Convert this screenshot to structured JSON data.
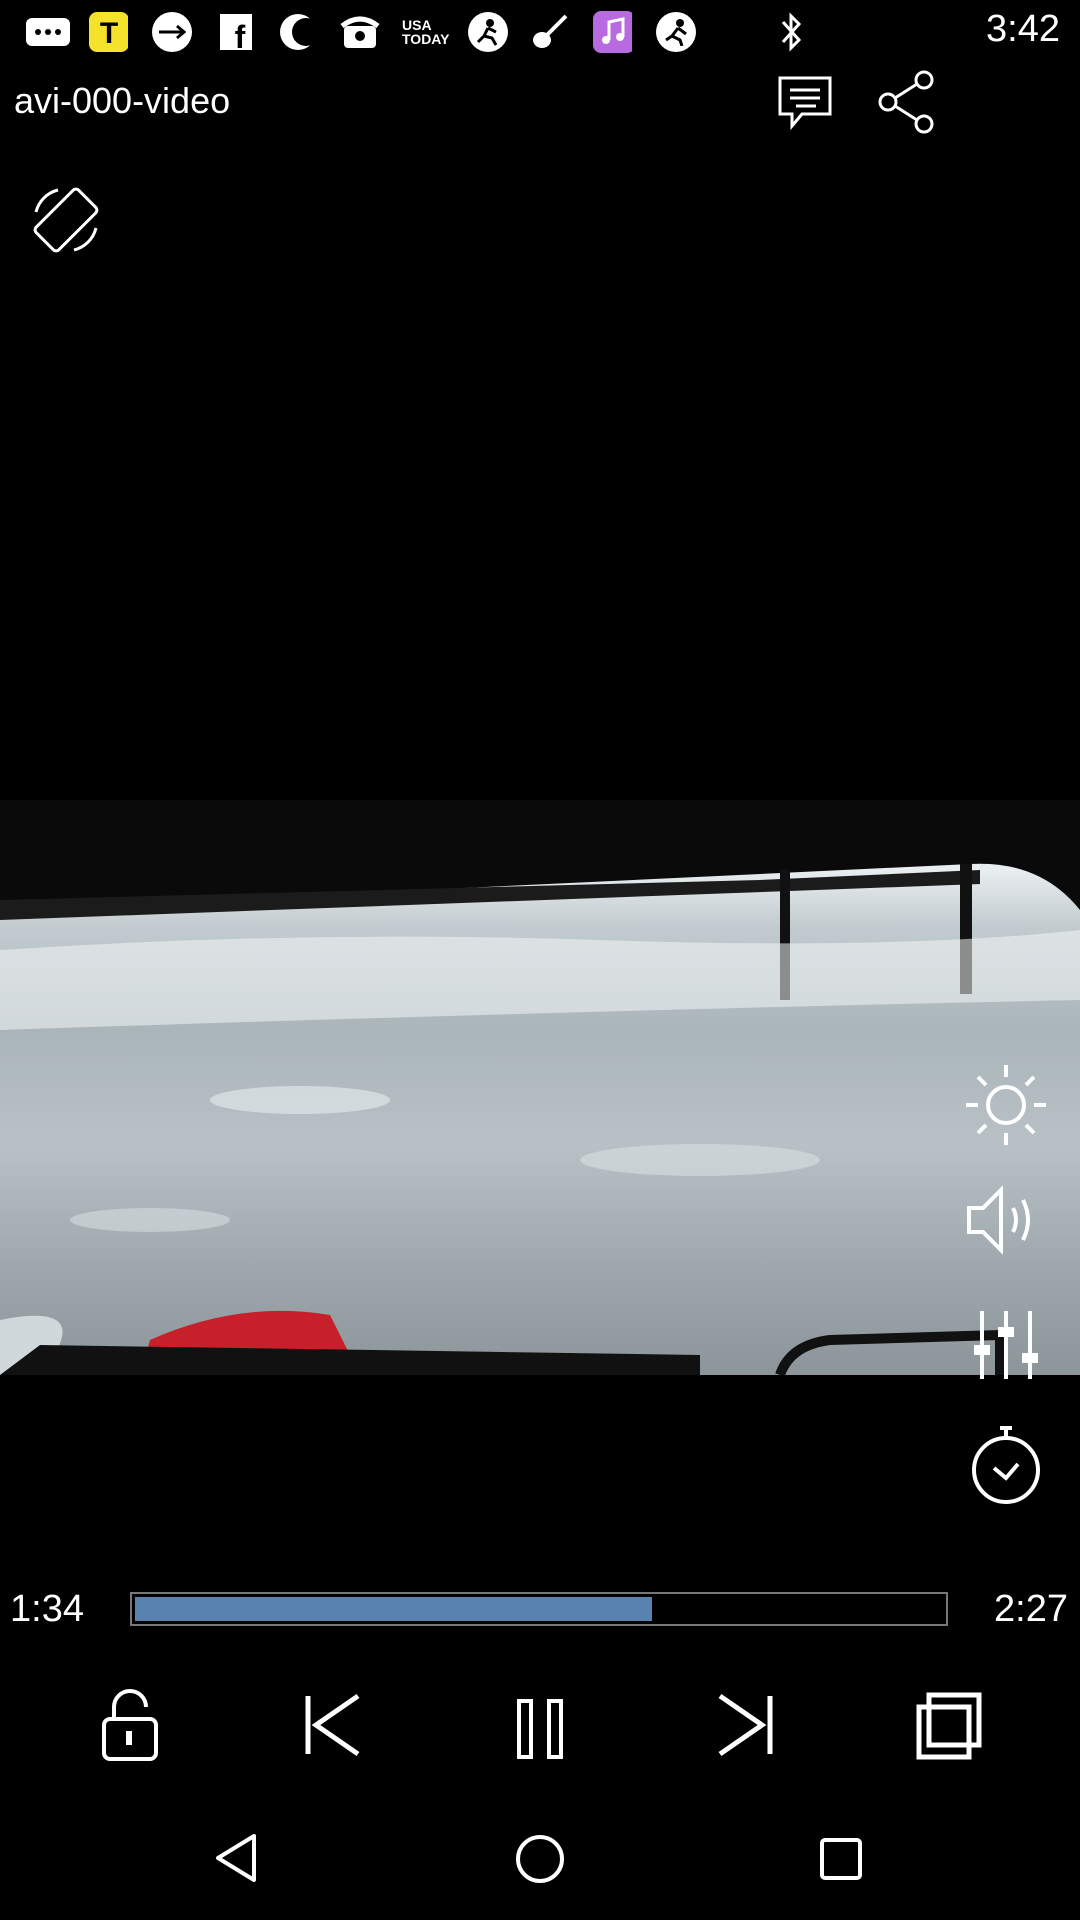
{
  "status_bar": {
    "time": "3:42",
    "icons": [
      "more-icon",
      "t-app-icon",
      "usb-icon",
      "facebook-icon",
      "moon-icon",
      "phone-icon",
      "usa-today-icon",
      "soccer-icon",
      "violin-icon",
      "music-app-icon",
      "running-icon",
      "bluetooth-icon"
    ],
    "usa_today_text": "USA TODAY"
  },
  "header": {
    "title": "avi-000-video",
    "subtitles_icon": "subtitles-icon",
    "share_icon": "share-icon"
  },
  "rotate_icon": "screen-rotation-icon",
  "side_controls": [
    "brightness-icon",
    "volume-icon",
    "equalizer-icon",
    "timer-icon"
  ],
  "playback": {
    "current_time": "1:34",
    "total_time": "2:27",
    "progress": 0.64
  },
  "controls": [
    "unlock-icon",
    "previous-icon",
    "pause-icon",
    "next-icon",
    "crop-icon"
  ],
  "nav": [
    "back-icon",
    "home-icon",
    "recents-icon"
  ],
  "colors": {
    "progress": "#5a82b0",
    "music_app": "#b86be0",
    "t_app": "#f5e22a"
  }
}
